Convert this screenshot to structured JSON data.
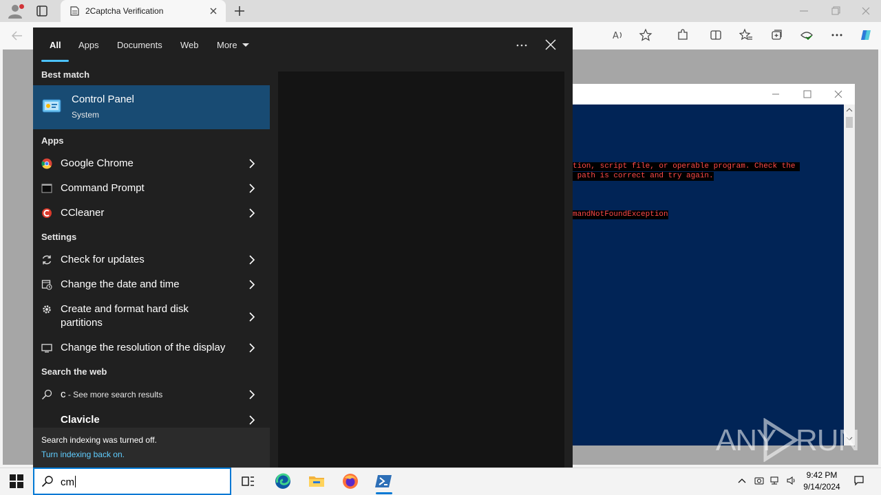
{
  "browser": {
    "tab_title": "2Captcha Verification",
    "new_tab_icon": "plus-icon",
    "window_controls": [
      "minimize-icon",
      "restore-icon",
      "close-icon"
    ],
    "toolbar_icons": [
      "read-aloud-icon",
      "favorite-star-icon",
      "extensions-icon",
      "split-screen-icon",
      "favorites-icon",
      "collections-icon",
      "browser-essentials-icon",
      "more-icon",
      "copilot-icon"
    ]
  },
  "powershell": {
    "error_lines": [
      "tion, script file, or operable program. Check the ",
      " path is correct and try again.",
      "mandNotFoundException"
    ]
  },
  "start_search": {
    "filters": {
      "all": "All",
      "apps": "Apps",
      "documents": "Documents",
      "web": "Web",
      "more": "More"
    },
    "best_match": {
      "heading": "Best match",
      "name": "Control Panel",
      "type": "System"
    },
    "apps": {
      "heading": "Apps",
      "items": [
        "Google Chrome",
        "Command Prompt",
        "CCleaner"
      ]
    },
    "settings": {
      "heading": "Settings",
      "items": [
        "Check for updates",
        "Change the date and time",
        "Create and format hard disk partitions",
        "Change the resolution of the display"
      ]
    },
    "web": {
      "heading": "Search the web",
      "query": "c",
      "suffix": " - See more search results",
      "suggestion": "Clavicle"
    },
    "indexing": {
      "message": "Search indexing was turned off.",
      "link": "Turn indexing back on."
    }
  },
  "taskbar": {
    "search_value": "cm",
    "time": "9:42 PM",
    "date": "9/14/2024"
  },
  "watermark": {
    "left": "ANY",
    "right": "RUN"
  },
  "colors": {
    "accent": "#0078d4",
    "selection": "#184b73",
    "powershell_bg": "#012456",
    "error_text": "#ff4a4a",
    "link": "#60cdff"
  }
}
